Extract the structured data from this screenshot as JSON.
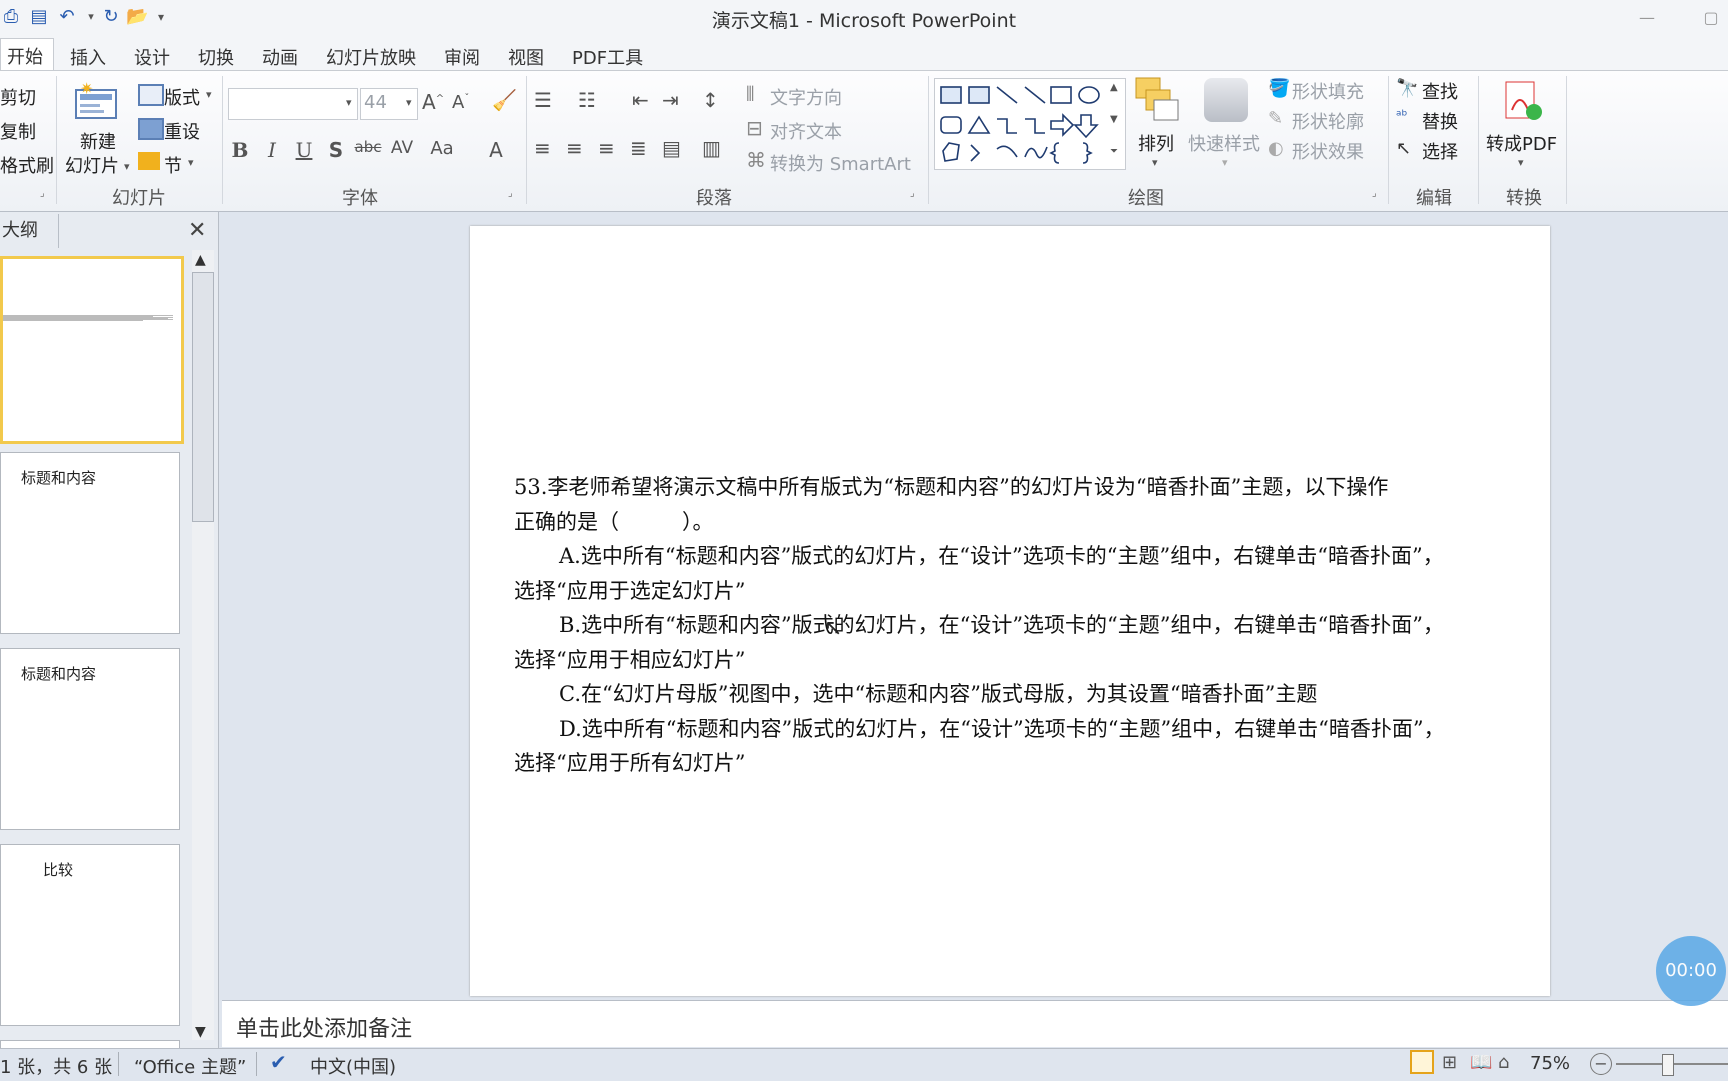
{
  "window": {
    "title": "演示文稿1 - Microsoft PowerPoint"
  },
  "tabs": [
    "开始",
    "插入",
    "设计",
    "切换",
    "动画",
    "幻灯片放映",
    "审阅",
    "视图",
    "PDF工具"
  ],
  "ribbon": {
    "clipboard": {
      "cut": "剪切",
      "copy": "复制",
      "format_painter": "格式刷"
    },
    "slides": {
      "new_slide_line1": "新建",
      "new_slide_line2": "幻灯片",
      "layout": "版式",
      "reset": "重设",
      "section": "节",
      "group_label": "幻灯片"
    },
    "font": {
      "font_size": "44",
      "group_label": "字体"
    },
    "paragraph": {
      "text_direction": "文字方向",
      "align_text": "对齐文本",
      "convert_smartart": "转换为 SmartArt",
      "group_label": "段落"
    },
    "drawing": {
      "arrange": "排列",
      "quick_styles": "快速样式",
      "shape_fill": "形状填充",
      "shape_outline": "形状轮廓",
      "shape_effects": "形状效果",
      "group_label": "绘图"
    },
    "editing": {
      "find": "查找",
      "replace": "替换",
      "select": "选择",
      "group_label": "编辑"
    },
    "convert": {
      "to_pdf": "转成PDF",
      "group_label": "转换"
    }
  },
  "left_pane": {
    "tab": "大纲",
    "thumbnails": [
      {
        "title": ""
      },
      {
        "title": "标题和内容"
      },
      {
        "title": "标题和内容"
      },
      {
        "title": "比较"
      }
    ]
  },
  "slide": {
    "question_line1": "53.李老师希望将演示文稿中所有版式为“标题和内容”的幻灯片设为“暗香扑面”主题，以下操作",
    "question_line2": "正确的是（　　　）。",
    "option_a_1": "A.选中所有“标题和内容”版式的幻灯片，在“设计”选项卡的“主题”组中，右键单击“暗香扑面”，",
    "option_a_2": "选择“应用于选定幻灯片”",
    "option_b_1": "B.选中所有“标题和内容”版式的幻灯片，在“设计”选项卡的“主题”组中，右键单击“暗香扑面”，",
    "option_b_2": "选择“应用于相应幻灯片”",
    "option_c": "C.在“幻灯片母版”视图中，选中“标题和内容”版式母版，为其设置“暗香扑面”主题",
    "option_d_1": "D.选中所有“标题和内容”版式的幻灯片，在“设计”选项卡的“主题”组中，右键单击“暗香扑面”，",
    "option_d_2": "选择“应用于所有幻灯片”"
  },
  "notes": {
    "placeholder": "单击此处添加备注"
  },
  "status": {
    "slide_count": "1 张，共 6 张",
    "theme": "“Office 主题”",
    "language": "中文(中国)",
    "zoom": "75%"
  },
  "overlay": {
    "timer": "00:00"
  }
}
